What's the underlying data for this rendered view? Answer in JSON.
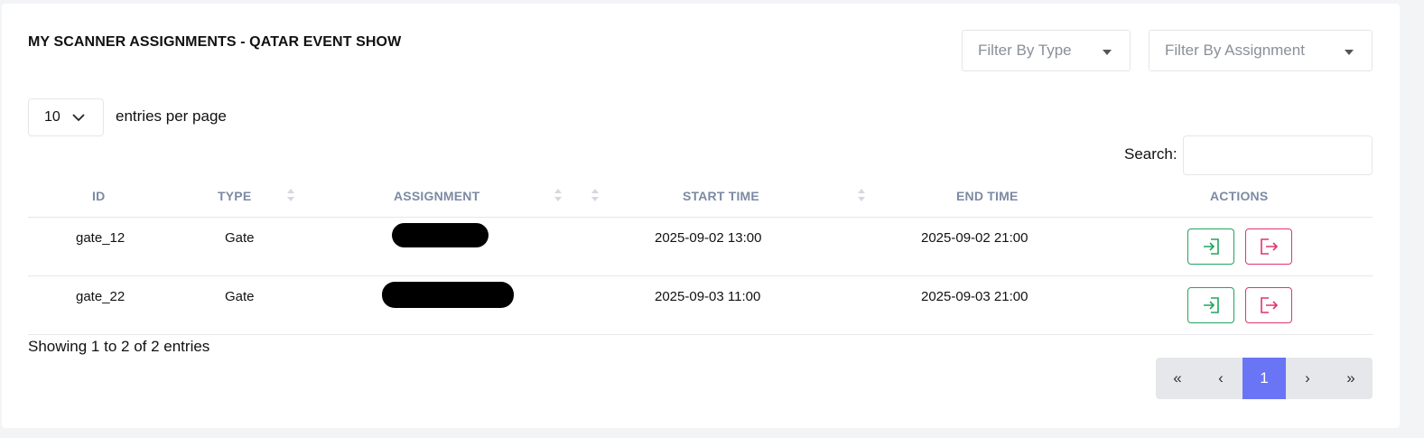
{
  "title": "MY SCANNER ASSIGNMENTS - QATAR EVENT SHOW",
  "filters": {
    "type_placeholder": "Filter By Type",
    "assignment_placeholder": "Filter By Assignment"
  },
  "entries": {
    "value": "10",
    "label": "entries per page"
  },
  "search": {
    "label": "Search:",
    "value": ""
  },
  "table": {
    "columns": [
      "ID",
      "TYPE",
      "ASSIGNMENT",
      "START TIME",
      "END TIME",
      "ACTIONS"
    ],
    "rows": [
      {
        "id": "gate_12",
        "type": "Gate",
        "assignment": "",
        "start": "2025-09-02 13:00",
        "end": "2025-09-02 21:00"
      },
      {
        "id": "gate_22",
        "type": "Gate",
        "assignment": "",
        "start": "2025-09-03 11:00",
        "end": "2025-09-03 21:00"
      }
    ]
  },
  "footer": {
    "info": "Showing 1 to 2 of 2 entries"
  },
  "pagination": {
    "first": "«",
    "prev": "‹",
    "current": "1",
    "next": "›",
    "last": "»"
  },
  "icons": {
    "checkin": "sign-in-icon",
    "checkout": "sign-out-icon"
  },
  "colors": {
    "checkin": "#22a45d",
    "checkout": "#e0356f",
    "active_page": "#6a75f5",
    "header_text": "#7d8aa3"
  }
}
